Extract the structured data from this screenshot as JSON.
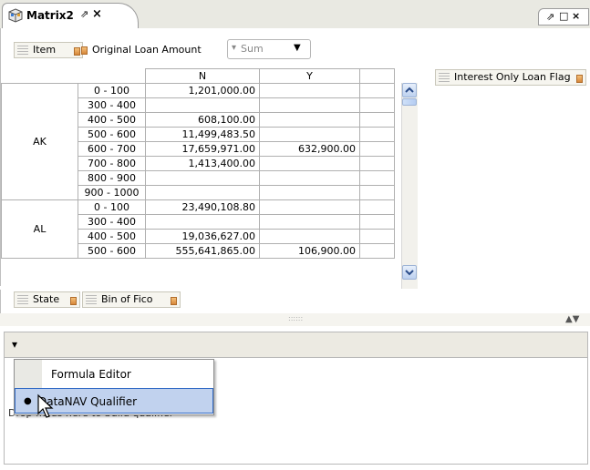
{
  "tab": {
    "title": "Matrix2",
    "pin": "⇗",
    "close": "×"
  },
  "view_controls": {
    "restore": "⇗",
    "maximize": "□",
    "close": "×"
  },
  "toolbar": {
    "item_label": "Item",
    "measure_label": "Original Loan Amount",
    "aggregate": "Sum",
    "column_field": "Interest Only Loan Flag"
  },
  "matrix": {
    "columns": [
      "N",
      "Y"
    ],
    "groups": [
      {
        "state": "AK",
        "rows": [
          {
            "bin": "0 - 100",
            "n": "1,201,000.00",
            "y": ""
          },
          {
            "bin": "300 - 400",
            "n": "",
            "y": ""
          },
          {
            "bin": "400 - 500",
            "n": "608,100.00",
            "y": ""
          },
          {
            "bin": "500 - 600",
            "n": "11,499,483.50",
            "y": ""
          },
          {
            "bin": "600 - 700",
            "n": "17,659,971.00",
            "y": "632,900.00"
          },
          {
            "bin": "700 - 800",
            "n": "1,413,400.00",
            "y": ""
          },
          {
            "bin": "800 - 900",
            "n": "",
            "y": ""
          },
          {
            "bin": "900 - 1000",
            "n": "",
            "y": ""
          }
        ]
      },
      {
        "state": "AL",
        "rows": [
          {
            "bin": "0 - 100",
            "n": "23,490,108.80",
            "y": ""
          },
          {
            "bin": "300 - 400",
            "n": "",
            "y": ""
          },
          {
            "bin": "400 - 500",
            "n": "19,036,627.00",
            "y": ""
          },
          {
            "bin": "500 - 600",
            "n": "555,641,865.00",
            "y": "106,900.00"
          }
        ]
      }
    ]
  },
  "row_fields": {
    "state": "State",
    "bin": "Bin of Fico"
  },
  "splitter": {
    "grip": "::::::",
    "arrows": "▲▼"
  },
  "bottom": {
    "dropdown_glyph": "▾",
    "menu_items": [
      "Formula Editor",
      "DataNAV Qualifier"
    ],
    "hint_text": "Drop fields here to build qualifier"
  }
}
